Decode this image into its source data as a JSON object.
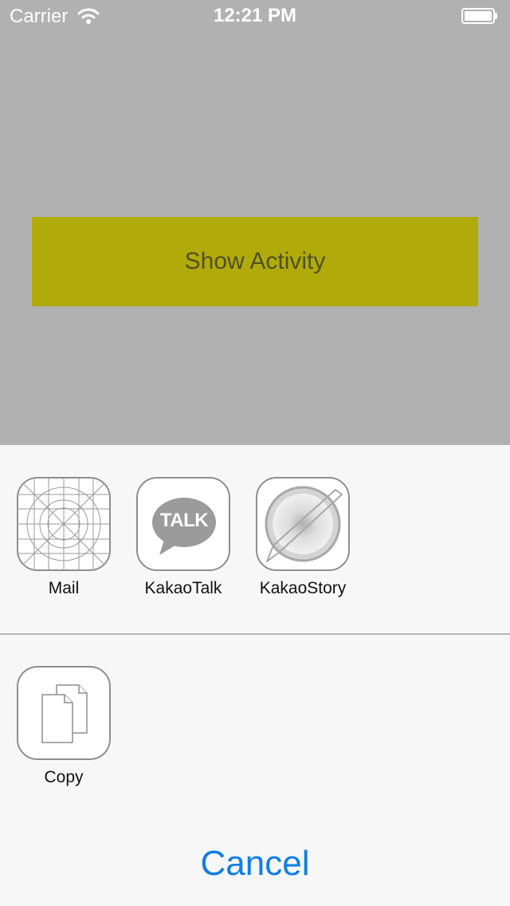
{
  "status_bar": {
    "carrier": "Carrier",
    "time": "12:21 PM",
    "icons": [
      "wifi-icon",
      "battery-icon"
    ]
  },
  "main": {
    "show_activity_label": "Show Activity",
    "button_color": "#b1aa0b",
    "background_color": "#b1b1b1"
  },
  "share_sheet": {
    "apps": [
      {
        "label": "Mail",
        "icon": "mail-placeholder-icon"
      },
      {
        "label": "KakaoTalk",
        "icon": "kakaotalk-icon",
        "icon_text": "TALK"
      },
      {
        "label": "KakaoStory",
        "icon": "kakaostory-icon"
      }
    ],
    "actions": [
      {
        "label": "Copy",
        "icon": "copy-icon"
      }
    ],
    "cancel_label": "Cancel",
    "accent_color": "#117ee8"
  }
}
